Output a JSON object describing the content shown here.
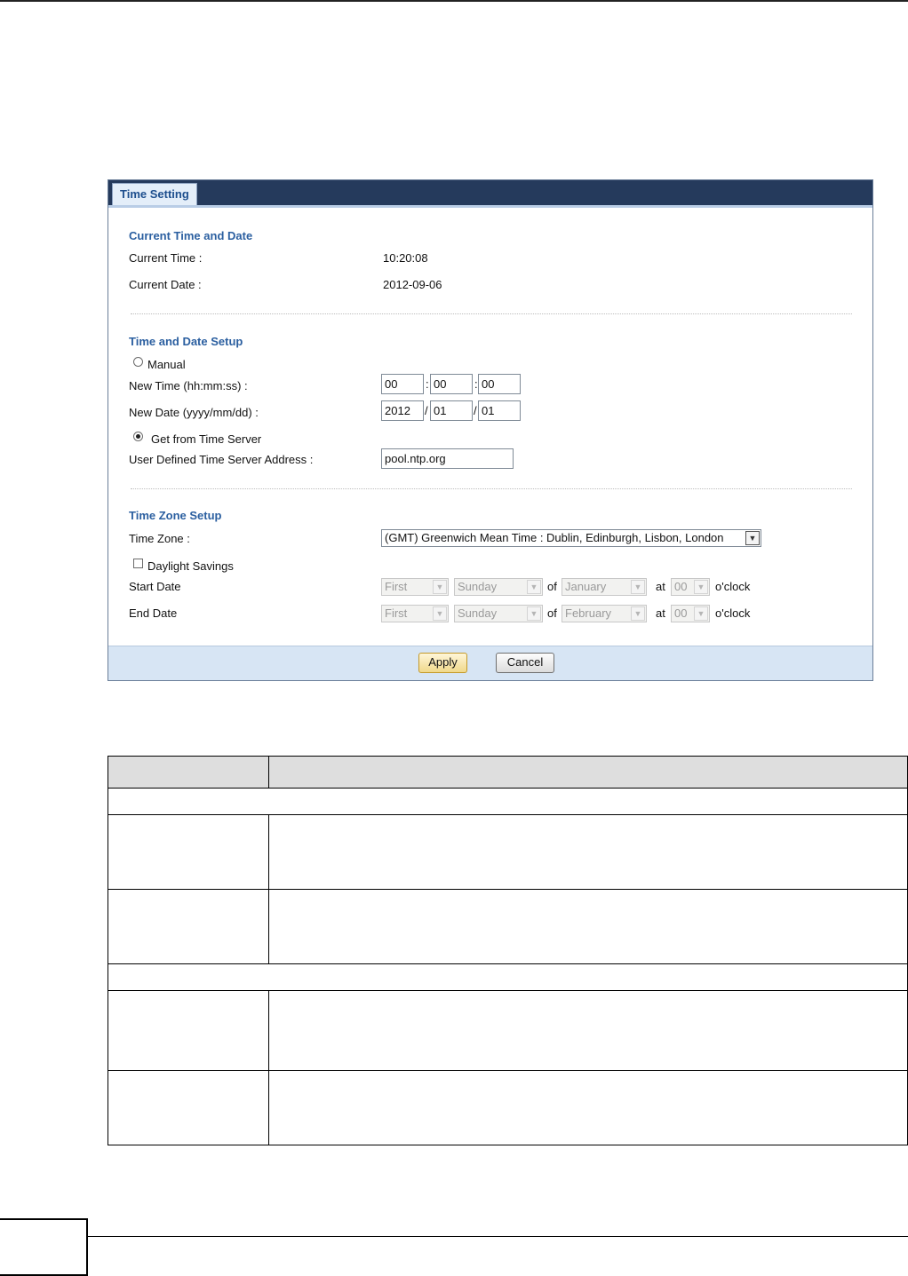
{
  "window": {
    "tab_label": "Time Setting"
  },
  "current": {
    "section_title": "Current Time and Date",
    "time_label": "Current Time :",
    "time_value": "10:20:08",
    "date_label": "Current Date :",
    "date_value": "2012-09-06"
  },
  "setup": {
    "section_title": "Time and Date Setup",
    "manual_label": "Manual",
    "manual_checked": false,
    "new_time_label": "New Time (hh:mm:ss) :",
    "hour": "00",
    "minute": "00",
    "second": "00",
    "time_sep": ":",
    "new_date_label": "New Date (yyyy/mm/dd) :",
    "year": "2012",
    "month": "01",
    "day": "01",
    "date_sep": "/",
    "server_label": "Get from Time Server",
    "server_checked": true,
    "server_address_label": "User Defined Time Server Address :",
    "server_address": "pool.ntp.org"
  },
  "timezone": {
    "section_title": "Time Zone Setup",
    "zone_label": "Time Zone :",
    "zone_value": "(GMT) Greenwich Mean Time : Dublin, Edinburgh, Lisbon, London",
    "dst_label": "Daylight Savings",
    "dst_checked": false,
    "start_label": "Start Date",
    "start_week": "First",
    "start_day": "Sunday",
    "start_month": "January",
    "start_hour": "00",
    "end_label": "End Date",
    "end_week": "First",
    "end_day": "Sunday",
    "end_month": "February",
    "end_hour": "00",
    "of_text": "of",
    "at_text": "at",
    "oclock_text": "o'clock"
  },
  "buttons": {
    "apply": "Apply",
    "cancel": "Cancel"
  },
  "icons": {
    "dropdown": "chevron-down-icon"
  }
}
